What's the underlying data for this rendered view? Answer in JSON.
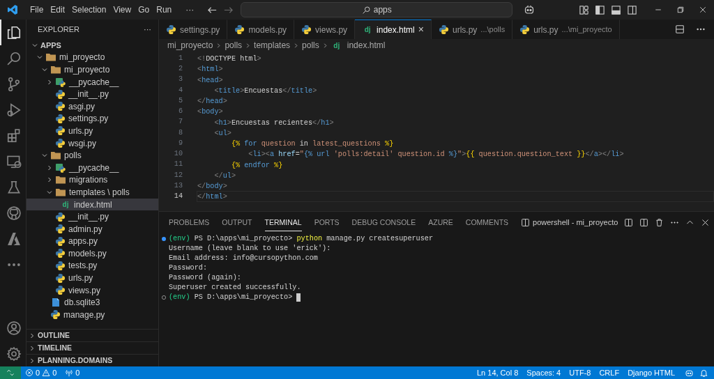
{
  "title_bar": {
    "menu": [
      "File",
      "Edit",
      "Selection",
      "View",
      "Go",
      "Run"
    ],
    "more": "···",
    "search": "apps"
  },
  "activity_bar": {
    "top": [
      {
        "kind": "explorer",
        "selected": true
      },
      {
        "kind": "search",
        "selected": false
      },
      {
        "kind": "source-control",
        "selected": false
      },
      {
        "kind": "run-debug",
        "selected": false
      },
      {
        "kind": "extensions",
        "selected": false
      },
      {
        "kind": "remote",
        "selected": false
      },
      {
        "kind": "testing",
        "selected": false
      },
      {
        "kind": "github",
        "selected": false
      },
      {
        "kind": "azure",
        "selected": false
      },
      {
        "kind": "more",
        "selected": false
      }
    ],
    "bottom": [
      {
        "kind": "account",
        "selected": false
      },
      {
        "kind": "settings",
        "selected": false
      }
    ]
  },
  "sidebar": {
    "title": "EXPLORER",
    "more": "···",
    "tree": {
      "label": "APPS",
      "kind": "root",
      "expanded": true,
      "selected": false,
      "children": [
        {
          "label": "mi_proyecto",
          "kind": "folder",
          "expanded": true,
          "selected": false,
          "children": [
            {
              "label": "mi_proyecto",
              "kind": "folder",
              "expanded": true,
              "selected": false,
              "children": [
                {
                  "label": "__pycache__",
                  "kind": "pycache",
                  "expanded": false,
                  "selected": false
                },
                {
                  "label": "__init__.py",
                  "kind": "python",
                  "selected": false
                },
                {
                  "label": "asgi.py",
                  "kind": "python",
                  "selected": false
                },
                {
                  "label": "settings.py",
                  "kind": "python",
                  "selected": false
                },
                {
                  "label": "urls.py",
                  "kind": "python",
                  "selected": false
                },
                {
                  "label": "wsgi.py",
                  "kind": "python",
                  "selected": false
                }
              ]
            },
            {
              "label": "polls",
              "kind": "folder",
              "expanded": true,
              "selected": false,
              "children": [
                {
                  "label": "__pycache__",
                  "kind": "pycache",
                  "expanded": false,
                  "selected": false
                },
                {
                  "label": "migrations",
                  "kind": "folder",
                  "expanded": false,
                  "selected": false
                },
                {
                  "label": "templates \\ polls",
                  "kind": "folder",
                  "expanded": true,
                  "selected": false,
                  "children": [
                    {
                      "label": "index.html",
                      "kind": "django",
                      "icon_glyph": "dj",
                      "selected": true
                    }
                  ]
                },
                {
                  "label": "__init__.py",
                  "kind": "python",
                  "selected": false
                },
                {
                  "label": "admin.py",
                  "kind": "python",
                  "selected": false
                },
                {
                  "label": "apps.py",
                  "kind": "python",
                  "selected": false
                },
                {
                  "label": "models.py",
                  "kind": "python",
                  "selected": false
                },
                {
                  "label": "tests.py",
                  "kind": "python",
                  "selected": false
                },
                {
                  "label": "urls.py",
                  "kind": "python",
                  "selected": false
                },
                {
                  "label": "views.py",
                  "kind": "python",
                  "selected": false
                }
              ]
            },
            {
              "label": "db.sqlite3",
              "kind": "database",
              "selected": false
            },
            {
              "label": "manage.py",
              "kind": "python",
              "selected": false
            }
          ]
        }
      ]
    },
    "sections": [
      {
        "label": "OUTLINE",
        "expanded": false
      },
      {
        "label": "TIMELINE",
        "expanded": false
      },
      {
        "label": "PLANNING.DOMAINS",
        "expanded": false
      }
    ]
  },
  "editor": {
    "tabs": [
      {
        "label": "settings.py",
        "kind": "python",
        "selected": false
      },
      {
        "label": "models.py",
        "kind": "python",
        "selected": false
      },
      {
        "label": "views.py",
        "kind": "python",
        "selected": false
      },
      {
        "label": "index.html",
        "kind": "django",
        "icon_glyph": "dj",
        "close": "×",
        "selected": true
      },
      {
        "label": "urls.py",
        "description": "...\\polls",
        "kind": "python",
        "selected": false
      },
      {
        "label": "urls.py",
        "description": "...\\mi_proyecto",
        "kind": "python",
        "selected": false
      }
    ],
    "breadcrumbs": [
      {
        "label": "mi_proyecto"
      },
      {
        "label": "polls"
      },
      {
        "label": "templates"
      },
      {
        "label": "polls"
      },
      {
        "label": "index.html",
        "icon_glyph": "dj"
      }
    ],
    "lines": [
      {
        "number": "1",
        "current": false,
        "tokens": [
          {
            "kind": "punct",
            "text": "<!"
          },
          {
            "kind": "text",
            "text": "DOCTYPE html"
          },
          {
            "kind": "punct",
            "text": ">"
          }
        ]
      },
      {
        "number": "2",
        "current": false,
        "tokens": [
          {
            "kind": "punct",
            "text": "<"
          },
          {
            "kind": "tag",
            "text": "html"
          },
          {
            "kind": "punct",
            "text": ">"
          }
        ]
      },
      {
        "number": "3",
        "current": false,
        "tokens": [
          {
            "kind": "punct",
            "text": "<"
          },
          {
            "kind": "tag",
            "text": "head"
          },
          {
            "kind": "punct",
            "text": ">"
          }
        ]
      },
      {
        "number": "4",
        "current": false,
        "tokens": [
          {
            "kind": "punct",
            "text": "    <"
          },
          {
            "kind": "tag",
            "text": "title"
          },
          {
            "kind": "punct",
            "text": ">"
          },
          {
            "kind": "text",
            "text": "Encuestas"
          },
          {
            "kind": "punct",
            "text": "</"
          },
          {
            "kind": "tag",
            "text": "title"
          },
          {
            "kind": "punct",
            "text": ">"
          }
        ]
      },
      {
        "number": "5",
        "current": false,
        "tokens": [
          {
            "kind": "punct",
            "text": "</"
          },
          {
            "kind": "tag",
            "text": "head"
          },
          {
            "kind": "punct",
            "text": ">"
          }
        ]
      },
      {
        "number": "6",
        "current": false,
        "tokens": [
          {
            "kind": "punct",
            "text": "<"
          },
          {
            "kind": "tag",
            "text": "body"
          },
          {
            "kind": "punct",
            "text": ">"
          }
        ]
      },
      {
        "number": "7",
        "current": false,
        "tokens": [
          {
            "kind": "punct",
            "text": "    <"
          },
          {
            "kind": "tag",
            "text": "h1"
          },
          {
            "kind": "punct",
            "text": ">"
          },
          {
            "kind": "text",
            "text": "Encuestas recientes"
          },
          {
            "kind": "punct",
            "text": "</"
          },
          {
            "kind": "tag",
            "text": "h1"
          },
          {
            "kind": "punct",
            "text": ">"
          }
        ]
      },
      {
        "number": "8",
        "current": false,
        "tokens": [
          {
            "kind": "punct",
            "text": "    <"
          },
          {
            "kind": "tag",
            "text": "ul"
          },
          {
            "kind": "punct",
            "text": ">"
          }
        ]
      },
      {
        "number": "9",
        "current": false,
        "tokens": [
          {
            "kind": "delim",
            "text": "        {%"
          },
          {
            "kind": "keyword",
            "text": " for"
          },
          {
            "kind": "string",
            "text": " question"
          },
          {
            "kind": "text",
            "text": " in"
          },
          {
            "kind": "string",
            "text": " latest_questions"
          },
          {
            "kind": "delim",
            "text": " %}"
          }
        ]
      },
      {
        "number": "10",
        "current": false,
        "tokens": [
          {
            "kind": "punct",
            "text": "            <"
          },
          {
            "kind": "tag",
            "text": "li"
          },
          {
            "kind": "punct",
            "text": "><"
          },
          {
            "kind": "tag",
            "text": "a"
          },
          {
            "kind": "attr",
            "text": " href"
          },
          {
            "kind": "text",
            "text": "="
          },
          {
            "kind": "string",
            "text": "\""
          },
          {
            "kind": "keyword",
            "text": "{% url"
          },
          {
            "kind": "string",
            "text": " 'polls:detail' question.id"
          },
          {
            "kind": "keyword",
            "text": " %}"
          },
          {
            "kind": "string",
            "text": "\""
          },
          {
            "kind": "punct",
            "text": ">"
          },
          {
            "kind": "delim",
            "text": "{{"
          },
          {
            "kind": "string",
            "text": " question.question_text"
          },
          {
            "kind": "delim",
            "text": " }}"
          },
          {
            "kind": "punct",
            "text": "</"
          },
          {
            "kind": "tag",
            "text": "a"
          },
          {
            "kind": "punct",
            "text": "></"
          },
          {
            "kind": "tag",
            "text": "li"
          },
          {
            "kind": "punct",
            "text": ">"
          }
        ]
      },
      {
        "number": "11",
        "current": false,
        "tokens": [
          {
            "kind": "delim",
            "text": "        {%"
          },
          {
            "kind": "keyword",
            "text": " endfor"
          },
          {
            "kind": "delim",
            "text": " %}"
          }
        ]
      },
      {
        "number": "12",
        "current": false,
        "tokens": [
          {
            "kind": "punct",
            "text": "    </"
          },
          {
            "kind": "tag",
            "text": "ul"
          },
          {
            "kind": "punct",
            "text": ">"
          }
        ]
      },
      {
        "number": "13",
        "current": false,
        "tokens": [
          {
            "kind": "punct",
            "text": "</"
          },
          {
            "kind": "tag",
            "text": "body"
          },
          {
            "kind": "punct",
            "text": ">"
          }
        ]
      },
      {
        "number": "14",
        "current": true,
        "tokens": [
          {
            "kind": "punct",
            "text": "</"
          },
          {
            "kind": "tag",
            "text": "html"
          },
          {
            "kind": "punct",
            "text": ">"
          }
        ]
      }
    ]
  },
  "panel": {
    "tabs": [
      {
        "label": "PROBLEMS",
        "selected": false
      },
      {
        "label": "OUTPUT",
        "selected": false
      },
      {
        "label": "TERMINAL",
        "selected": true
      },
      {
        "label": "PORTS",
        "selected": false
      },
      {
        "label": "DEBUG CONSOLE",
        "selected": false
      },
      {
        "label": "AZURE",
        "selected": false
      },
      {
        "label": "COMMENTS",
        "selected": false
      }
    ],
    "terminal_name": "powershell - mi_proyecto",
    "lines": [
      {
        "finished": true,
        "tokens": [
          {
            "kind": "env",
            "text": "(env)"
          },
          {
            "kind": "text",
            "text": " PS D:\\apps\\mi_proyecto> "
          },
          {
            "kind": "command",
            "text": "python"
          },
          {
            "kind": "text",
            "text": " manage.py createsuperuser"
          }
        ]
      },
      {
        "tokens": [
          {
            "kind": "text",
            "text": "Username (leave blank to use 'erick'):"
          }
        ]
      },
      {
        "tokens": [
          {
            "kind": "text",
            "text": "Email address: info@cursopython.com"
          }
        ]
      },
      {
        "tokens": [
          {
            "kind": "text",
            "text": "Password:"
          }
        ]
      },
      {
        "tokens": [
          {
            "kind": "text",
            "text": "Password (again):"
          }
        ]
      },
      {
        "tokens": [
          {
            "kind": "text",
            "text": "Superuser created successfully."
          }
        ]
      },
      {
        "finished": false,
        "cursor": true,
        "tokens": [
          {
            "kind": "env",
            "text": "(env)"
          },
          {
            "kind": "text",
            "text": " PS D:\\apps\\mi_proyecto> "
          }
        ]
      }
    ]
  },
  "status_bar": {
    "errors": "0",
    "warnings": "0",
    "ports": "0",
    "right": [
      "Ln 14, Col 8",
      "Spaces: 4",
      "UTF-8",
      "CRLF",
      "Django HTML"
    ]
  }
}
